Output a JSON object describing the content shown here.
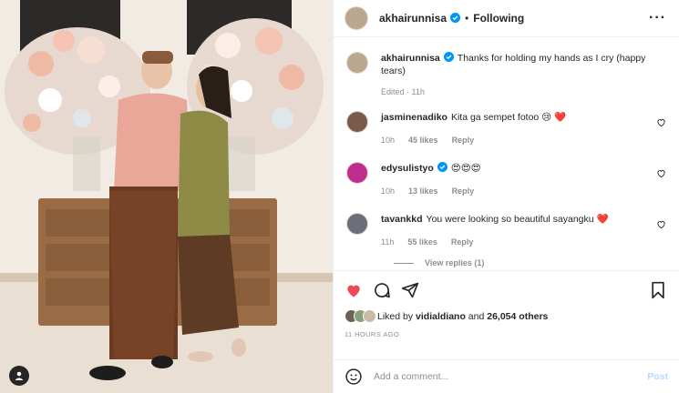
{
  "post": {
    "author": "akhairunnisa",
    "follow_status": "Following",
    "caption": "Thanks for holding my hands as I cry (happy tears)",
    "edited": "Edited · 11h"
  },
  "comments": [
    {
      "user": "jasminenadiko",
      "verified": false,
      "text": "Kita ga sempet fotoo 😢 ❤️",
      "age": "10h",
      "likes": "45 likes",
      "reply": "Reply"
    },
    {
      "user": "edysulistyo",
      "verified": true,
      "text": "😍😍😍",
      "age": "10h",
      "likes": "13 likes",
      "reply": "Reply"
    },
    {
      "user": "tavankkd",
      "verified": false,
      "text": "You were looking so beautiful sayangku ❤️",
      "age": "11h",
      "likes": "55 likes",
      "reply": "Reply"
    }
  ],
  "view_replies": "View replies (1)",
  "likes": {
    "prefix": "Liked by",
    "user": "vidialdiano",
    "and": "and",
    "others": "26,054 others"
  },
  "timestamp": "11 HOURS AGO",
  "add_comment": {
    "placeholder": "Add a comment...",
    "post_label": "Post"
  },
  "colors": {
    "like_red": "#ed4956",
    "verified_blue": "#0095f6",
    "post_disabled": "#b3dbff"
  },
  "icons": [
    "more-icon",
    "heart-icon",
    "comment-icon",
    "share-icon",
    "bookmark-icon",
    "emoji-icon",
    "user-tag-icon",
    "verified-icon"
  ]
}
